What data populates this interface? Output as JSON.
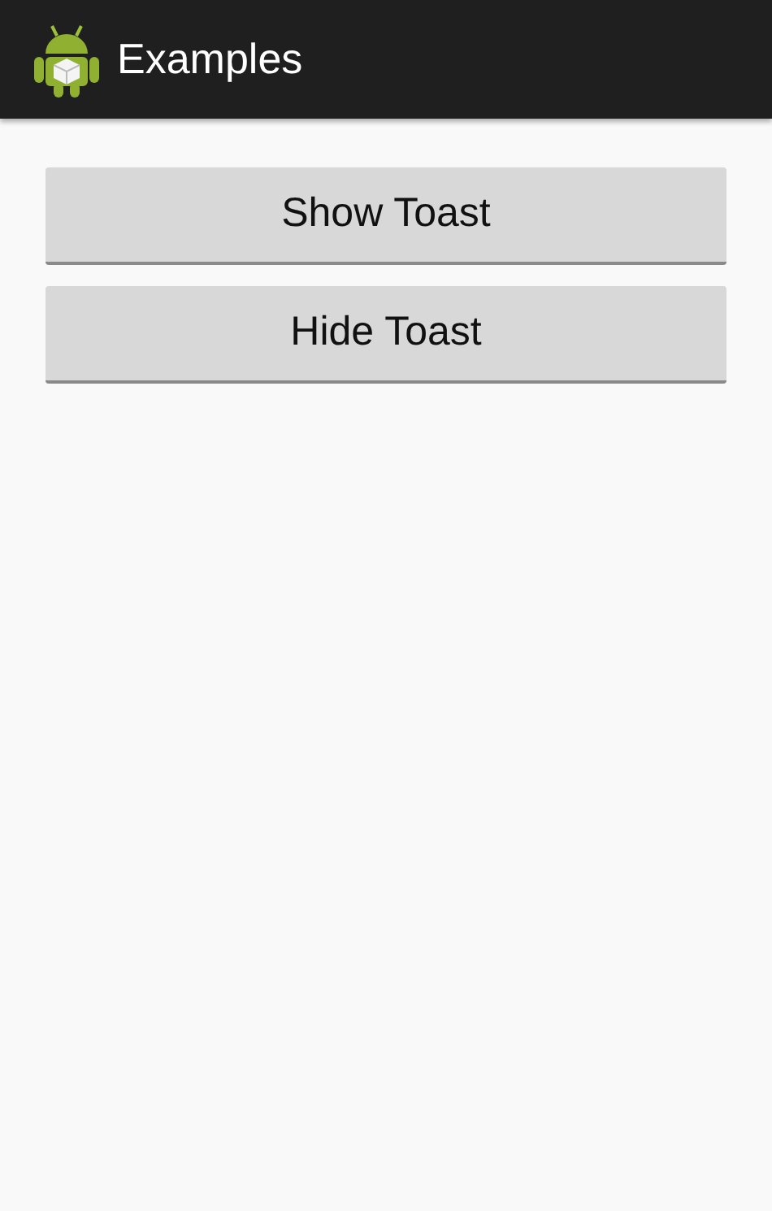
{
  "action_bar": {
    "title": "Examples"
  },
  "buttons": [
    {
      "label": "Show Toast"
    },
    {
      "label": "Hide Toast"
    }
  ]
}
